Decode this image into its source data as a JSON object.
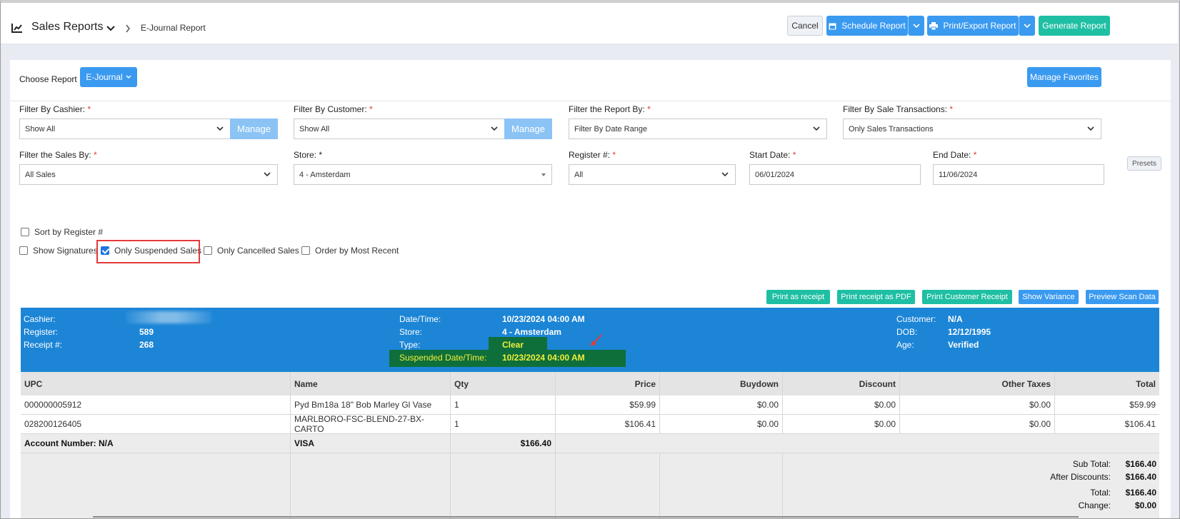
{
  "header": {
    "title": "Sales Reports",
    "breadcrumb": "E-Journal Report",
    "buttons": {
      "cancel": "Cancel",
      "schedule": "Schedule Report",
      "print_export": "Print/Export Report",
      "generate": "Generate Report"
    }
  },
  "report": {
    "choose_label": "Choose Report",
    "choose_value": "E-Journal",
    "manage_favorites": "Manage Favorites"
  },
  "filters": {
    "cashier": {
      "label": "Filter By Cashier:",
      "value": "Show All",
      "manage": "Manage"
    },
    "customer": {
      "label": "Filter By Customer:",
      "value": "Show All",
      "manage": "Manage"
    },
    "report_by": {
      "label": "Filter the Report By:",
      "value": "Filter By Date Range"
    },
    "sale_transactions": {
      "label": "Filter By Sale Transactions:",
      "value": "Only Sales Transactions"
    },
    "sales_by": {
      "label": "Filter the Sales By:",
      "value": "All Sales"
    },
    "store": {
      "label": "Store:",
      "required_mark": "*",
      "value": "4 - Amsterdam"
    },
    "register": {
      "label": "Register #:",
      "value": "All"
    },
    "start_date": {
      "label": "Start Date:",
      "value": "06/01/2024"
    },
    "end_date": {
      "label": "End Date:",
      "value": "11/06/2024"
    },
    "presets": "Presets",
    "required_star": "*"
  },
  "options": {
    "sort_by_register": {
      "label": "Sort by Register #",
      "checked": false
    },
    "show_signatures": {
      "label": "Show Signatures",
      "checked": false
    },
    "only_suspended": {
      "label": "Only Suspended Sales",
      "checked": true
    },
    "only_cancelled": {
      "label": "Only Cancelled Sales",
      "checked": false
    },
    "order_recent": {
      "label": "Order by Most Recent",
      "checked": false
    }
  },
  "actions": {
    "print_receipt": "Print as receipt",
    "print_pdf": "Print receipt as PDF",
    "print_customer": "Print Customer Receipt",
    "show_variance": "Show Variance",
    "preview_scan": "Preview Scan Data"
  },
  "receipt": {
    "cashier_label": "Cashier:",
    "register_label": "Register:",
    "register": "589",
    "receipt_label": "Receipt #:",
    "receipt": "268",
    "datetime_label": "Date/Time:",
    "datetime": "10/23/2024 04:00 AM",
    "store_label": "Store:",
    "store": "4 - Amsterdam",
    "type_label": "Type:",
    "type": "Clear",
    "suspended_label": "Suspended Date/Time:",
    "suspended": "10/23/2024 04:00 AM",
    "customer_label": "Customer:",
    "customer": "N/A",
    "dob_label": "DOB:",
    "dob": "12/12/1995",
    "age_label": "Age:",
    "age": "Verified"
  },
  "table": {
    "columns": [
      "UPC",
      "Name",
      "Qty",
      "Price",
      "Buydown",
      "Discount",
      "Other Taxes",
      "Total"
    ],
    "rows": [
      [
        "000000005912",
        "Pyd Bm18a 18\" Bob Marley Gl Vase",
        "1",
        "$59.99",
        "$0.00",
        "$0.00",
        "$0.00",
        "$59.99"
      ],
      [
        "028200126405",
        "MARLBORO-FSC-BLEND-27-BX-CARTO",
        "1",
        "$106.41",
        "$0.00",
        "$0.00",
        "$0.00",
        "$106.41"
      ]
    ],
    "payment": {
      "account": "Account Number: N/A",
      "method": "VISA",
      "amount": "$166.40"
    },
    "totals": {
      "sub_total_label": "Sub Total:",
      "sub_total": "$166.40",
      "after_disc_label": "After Discounts:",
      "after_disc": "$166.40",
      "total_label": "Total:",
      "total": "$166.40",
      "change_label": "Change:",
      "change": "$0.00"
    }
  }
}
